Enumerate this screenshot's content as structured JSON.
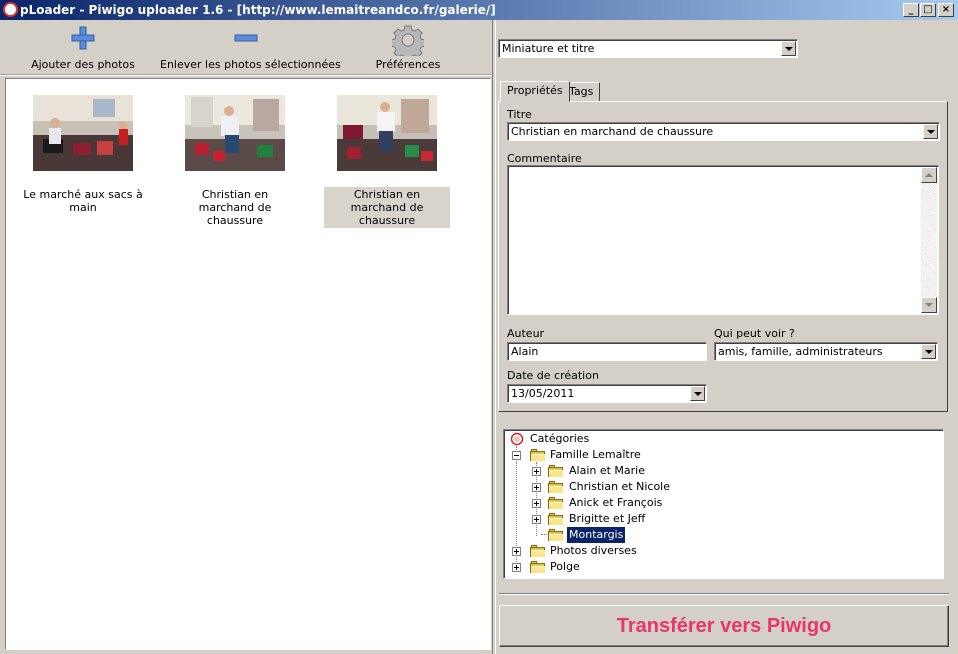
{
  "window": {
    "title": "pLoader - Piwigo uploader 1.6 - [http://www.lemaitreandco.fr/galerie/]"
  },
  "toolbar": {
    "add_label": "Ajouter des photos",
    "remove_label": "Enlever les photos sélectionnées",
    "prefs_label": "Préférences"
  },
  "view": {
    "selected": "Miniature et titre"
  },
  "photos": [
    {
      "caption": "Le marché aux sacs à main",
      "selected": false
    },
    {
      "caption": "Christian en marchand de chaussure",
      "selected": false
    },
    {
      "caption": "Christian en marchand de chaussure",
      "selected": true
    }
  ],
  "tabs": [
    {
      "label": "Propriétés",
      "active": true
    },
    {
      "label": "Tags",
      "active": false
    }
  ],
  "properties": {
    "title_label": "Titre",
    "title_value": "Christian en marchand de chaussure",
    "comment_label": "Commentaire",
    "comment_value": "",
    "author_label": "Auteur",
    "author_value": "Alain",
    "visibility_label": "Qui peut voir ?",
    "visibility_value": "amis, famille, administrateurs",
    "date_label": "Date de création",
    "date_value": "13/05/2011"
  },
  "categories": {
    "root": "Catégories",
    "items": [
      {
        "label": "Famille Lemaître",
        "level": 1,
        "expanded": true
      },
      {
        "label": "Alain et Marie",
        "level": 2
      },
      {
        "label": "Christian et Nicole",
        "level": 2
      },
      {
        "label": "Anick et François",
        "level": 2
      },
      {
        "label": "Brigitte et Jeff",
        "level": 2
      },
      {
        "label": "Montargis",
        "level": 2,
        "selected": true
      },
      {
        "label": "Photos diverses",
        "level": 1
      },
      {
        "label": "Polge",
        "level": 1
      }
    ]
  },
  "transfer": {
    "label": "Transférer vers Piwigo",
    "color": "#e8356a"
  }
}
